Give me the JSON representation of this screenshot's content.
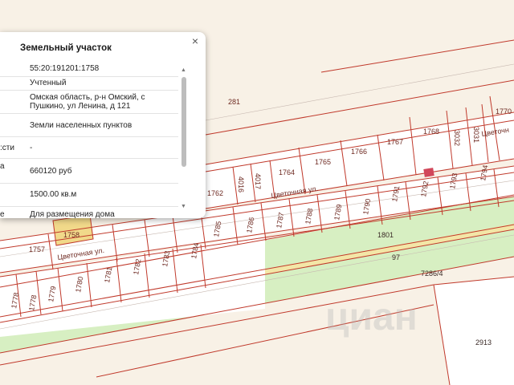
{
  "map": {
    "parcel_labels": [
      "281",
      "1770",
      "1768",
      "3032",
      "3031",
      "1767",
      "1766",
      "1765",
      "4017",
      "1764",
      "4016",
      "1762",
      "1757",
      "1758",
      "1785",
      "1786",
      "1787",
      "1788",
      "1789",
      "1790",
      "1791",
      "1792",
      "1793",
      "1794",
      "1784",
      "1783",
      "1782",
      "1781",
      "1780",
      "1779",
      "1778",
      "1801",
      "97",
      "7286/4",
      "2913",
      "1778"
    ],
    "street_labels": [
      "Цветочная ул.",
      "Цветочная ул.",
      "Цветочн"
    ],
    "colors": {
      "background": "#f8f1e6",
      "boundary": "#c0392b",
      "road": "#d7efc2",
      "selected": "#f1d98a",
      "lot_fill": "#ffffff"
    }
  },
  "popup": {
    "title": "Земельный участок",
    "close_icon": "close-icon",
    "rows": [
      {
        "key": "",
        "value": "55:20:191201:1758"
      },
      {
        "key": "",
        "value": "Учтенный"
      },
      {
        "key": "",
        "value": "Омская область, р-н Омский, с Пушкино, ул Ленина, д 121"
      },
      {
        "key": "",
        "value": "Земли населенных пунктов"
      },
      {
        "key": "сти:",
        "value": "-"
      },
      {
        "key": "а",
        "value": "660120 руб"
      },
      {
        "key": "",
        "value": "1500.00 кв.м"
      },
      {
        "key": "е",
        "value": "Для размещения дома"
      }
    ]
  },
  "watermark": "циан"
}
